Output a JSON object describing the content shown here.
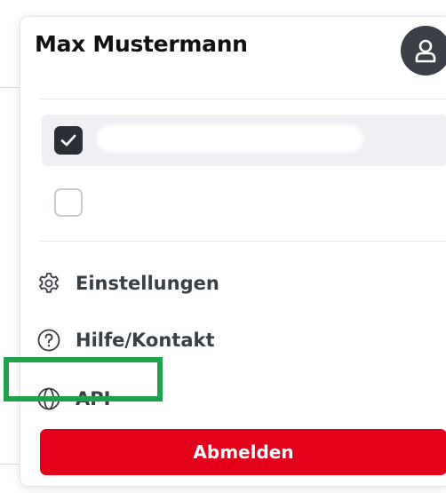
{
  "user": {
    "name": "Max Mustermann"
  },
  "accounts": [
    {
      "checked": true
    },
    {
      "checked": false
    }
  ],
  "menu": {
    "settings_label": "Einstellungen",
    "help_label": "Hilfe/Kontakt",
    "api_label": "API"
  },
  "logout_label": "Abmelden",
  "colors": {
    "logout_bg": "#e2001a",
    "highlight": "#1fa24b",
    "avatar_bg": "#3b3f47",
    "checkbox_checked": "#2a2e35",
    "selected_row_bg": "#eef0f3"
  },
  "icons": {
    "settings": "gear-icon",
    "help": "question-circle-icon",
    "api": "globe-icon",
    "avatar": "person-icon"
  }
}
